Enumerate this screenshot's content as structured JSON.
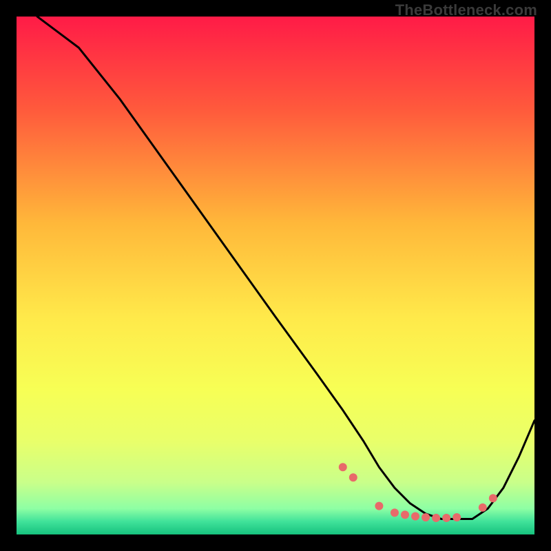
{
  "watermark": "TheBottleneck.com",
  "chart_data": {
    "type": "line",
    "title": "",
    "xlabel": "",
    "ylabel": "",
    "xlim": [
      0,
      100
    ],
    "ylim": [
      0,
      100
    ],
    "grid": false,
    "legend": false,
    "background_gradient": {
      "stops": [
        {
          "offset": 0.0,
          "color": "#ff1b47"
        },
        {
          "offset": 0.18,
          "color": "#ff5a3c"
        },
        {
          "offset": 0.4,
          "color": "#ffb83a"
        },
        {
          "offset": 0.58,
          "color": "#ffe94a"
        },
        {
          "offset": 0.72,
          "color": "#f7ff55"
        },
        {
          "offset": 0.82,
          "color": "#e9ff6a"
        },
        {
          "offset": 0.9,
          "color": "#c9ff8a"
        },
        {
          "offset": 0.95,
          "color": "#8effa4"
        },
        {
          "offset": 0.975,
          "color": "#40e29a"
        },
        {
          "offset": 1.0,
          "color": "#16c27e"
        }
      ]
    },
    "series": [
      {
        "name": "curve",
        "color": "#000000",
        "x": [
          4,
          8,
          12,
          20,
          30,
          40,
          50,
          58,
          63,
          67,
          70,
          73,
          76,
          79,
          82,
          85,
          88,
          91,
          94,
          97,
          100
        ],
        "y": [
          100,
          97,
          94,
          84,
          70,
          56,
          42,
          31,
          24,
          18,
          13,
          9,
          6,
          4,
          3,
          3,
          3,
          5,
          9,
          15,
          22
        ]
      }
    ],
    "markers": {
      "name": "dots",
      "color": "#e86a6a",
      "radius": 6,
      "x": [
        63,
        65,
        70,
        73,
        75,
        77,
        79,
        81,
        83,
        85,
        90,
        92
      ],
      "y": [
        13,
        11,
        5.5,
        4.2,
        3.8,
        3.5,
        3.3,
        3.2,
        3.2,
        3.3,
        5.2,
        7.0
      ]
    }
  }
}
